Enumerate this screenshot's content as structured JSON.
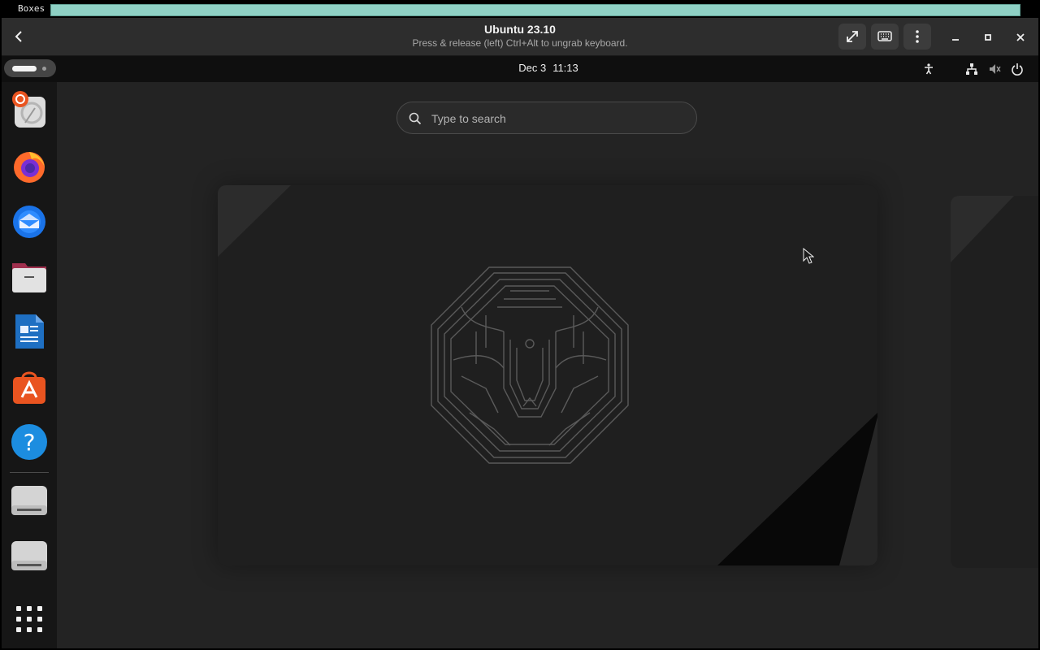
{
  "host_window": {
    "title": "Boxes"
  },
  "header": {
    "title": "Ubuntu 23.10",
    "subtitle": "Press & release (left) Ctrl+Alt to ungrab keyboard.",
    "buttons": [
      "back-icon",
      "fullscreen-icon",
      "keyboard-icon",
      "menu-icon",
      "minimize-icon",
      "maximize-icon",
      "close-icon"
    ]
  },
  "guest": {
    "topbar": {
      "date": "Dec 3",
      "time": "11:13",
      "tray_icons": [
        "accessibility-icon",
        "network-icon",
        "volume-muted-icon",
        "power-icon"
      ]
    },
    "dock": {
      "apps": [
        {
          "name": "Install Ubuntu",
          "icon": "ubuntu-installer-icon"
        },
        {
          "name": "Firefox",
          "icon": "firefox-icon"
        },
        {
          "name": "Thunderbird",
          "icon": "thunderbird-icon"
        },
        {
          "name": "Files",
          "icon": "files-icon"
        },
        {
          "name": "LibreOffice Writer",
          "icon": "writer-icon"
        },
        {
          "name": "App Center",
          "icon": "app-center-icon"
        },
        {
          "name": "Help",
          "icon": "help-icon"
        },
        {
          "name": "Drive 1",
          "icon": "drive-icon"
        },
        {
          "name": "Drive 2",
          "icon": "drive-icon"
        },
        {
          "name": "Show Apps",
          "icon": "app-grid-icon"
        }
      ]
    },
    "search": {
      "placeholder": "Type to search"
    }
  },
  "colors": {
    "header_bg": "#2d2d2d",
    "desktop_bg": "#232323",
    "topbar_bg": "#0f0f0f",
    "dock_bg": "#161616",
    "accent": "#e95420"
  }
}
